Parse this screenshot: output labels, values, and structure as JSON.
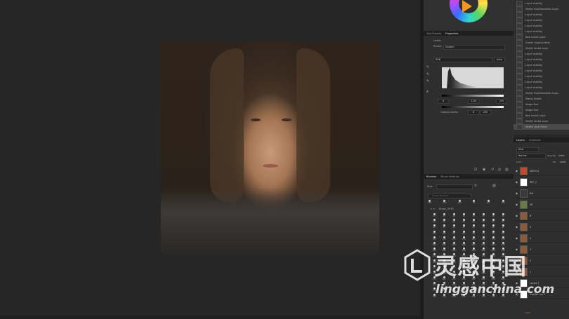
{
  "properties": {
    "tabs": [
      "Tool Presets",
      "Properties"
    ],
    "adjustment_label": "Levels",
    "preset_label": "Preset:",
    "preset_value": "Custom",
    "channel_value": "RGB",
    "auto_label": "Auto",
    "input_black": "0",
    "input_gamma": "1.00",
    "input_white": "255",
    "output_label": "Output Levels:",
    "output_black": "0",
    "output_white": "255"
  },
  "brushes": {
    "tabs": [
      "Brushes",
      "Brush Settings"
    ],
    "size_label": "Size:",
    "search_placeholder": "Search Brushes",
    "folder_name": "Brush_2015",
    "top_sizes": [
      "300",
      "300",
      "300",
      "40",
      "300",
      "300"
    ],
    "grid_numbers": [
      "30",
      "30",
      "30",
      "30",
      "30",
      "30",
      "30",
      "30",
      "25",
      "25",
      "25",
      "25",
      "25",
      "25",
      "25",
      "25",
      "40",
      "40",
      "40",
      "40",
      "40",
      "40",
      "40",
      "40",
      "60",
      "60",
      "60",
      "60",
      "60",
      "60",
      "60",
      "60",
      "100",
      "100",
      "100",
      "100",
      "100",
      "100",
      "100",
      "100",
      "500",
      "500",
      "500",
      "500",
      "500",
      "500",
      "500",
      "500",
      "200",
      "200",
      "200",
      "200",
      "200",
      "200",
      "200",
      "200",
      "300",
      "300",
      "300",
      "300",
      "300",
      "300",
      "300",
      "300",
      "150",
      "150",
      "150",
      "150",
      "150",
      "150",
      "150",
      "150",
      "90",
      "90",
      "90",
      "90",
      "90",
      "90",
      "90",
      "90",
      "120",
      "120",
      "120",
      "120",
      "120",
      "120",
      "120",
      "120",
      "250",
      "250",
      "250",
      "250",
      "250",
      "250",
      "250",
      "250",
      "100",
      "100",
      "100",
      "100",
      "100",
      "100",
      "100",
      "100",
      "175",
      "175",
      "175",
      "175",
      "175",
      "175",
      "175",
      "175",
      "136",
      "136",
      "136",
      "136",
      "136",
      "136",
      "136",
      "136"
    ]
  },
  "history": {
    "items": [
      "Layer Visibility",
      "Modify Hue/Saturation Layer",
      "Layer Visibility",
      "Layer Visibility",
      "Layer Visibility",
      "Layer Visibility",
      "New Levels Layer",
      "Create Clipping Mask",
      "Modify Levels Layer",
      "Layer Visibility",
      "Layer Visibility",
      "Layer Visibility",
      "Layer Visibility",
      "Layer Visibility",
      "Layer Visibility",
      "Layer Visibility",
      "Modify Hue/Saturation Layer",
      "Stamp Visible",
      "Image Size",
      "Image Size",
      "New Levels Layer",
      "Modify Levels Layer",
      "Delete Layer Mask"
    ]
  },
  "layers": {
    "tabs": [
      "Layers",
      "Channels"
    ],
    "kind_label": "Kind",
    "blend_mode": "Normal",
    "opacity_label": "Opacity:",
    "opacity_value": "100%",
    "lock_label": "Lock:",
    "fill_label": "Fill:",
    "fill_value": "100%",
    "items": [
      {
        "name": "SKETCH",
        "thumb": "#c04a2c"
      },
      {
        "name": "REF_1",
        "thumb": "#ffffff"
      },
      {
        "name": "Ref",
        "thumb": "#3a3a3a"
      },
      {
        "name": "30",
        "thumb": "#6a7a45"
      },
      {
        "name": "6",
        "thumb": "#8a5a3a"
      },
      {
        "name": "5",
        "thumb": "#8a5a3a"
      },
      {
        "name": "4",
        "thumb": "#8a5a3a"
      },
      {
        "name": "3",
        "thumb": "#8a5a3a"
      },
      {
        "name": "2",
        "thumb": "#8a5a3a"
      },
      {
        "name": "1",
        "thumb": "#8a5a3a"
      },
      {
        "name": "Levels 1",
        "thumb": "#ffffff"
      },
      {
        "name": "Hue/Sa...on 1",
        "thumb": "#ffffff"
      }
    ],
    "footer_label": "Layer"
  },
  "watermark": {
    "chinese": "灵感中国",
    "english": "lingganchina.com"
  },
  "colors": {
    "accent_orange": "#f39a1e",
    "sketch_red": "#c04a2c"
  }
}
